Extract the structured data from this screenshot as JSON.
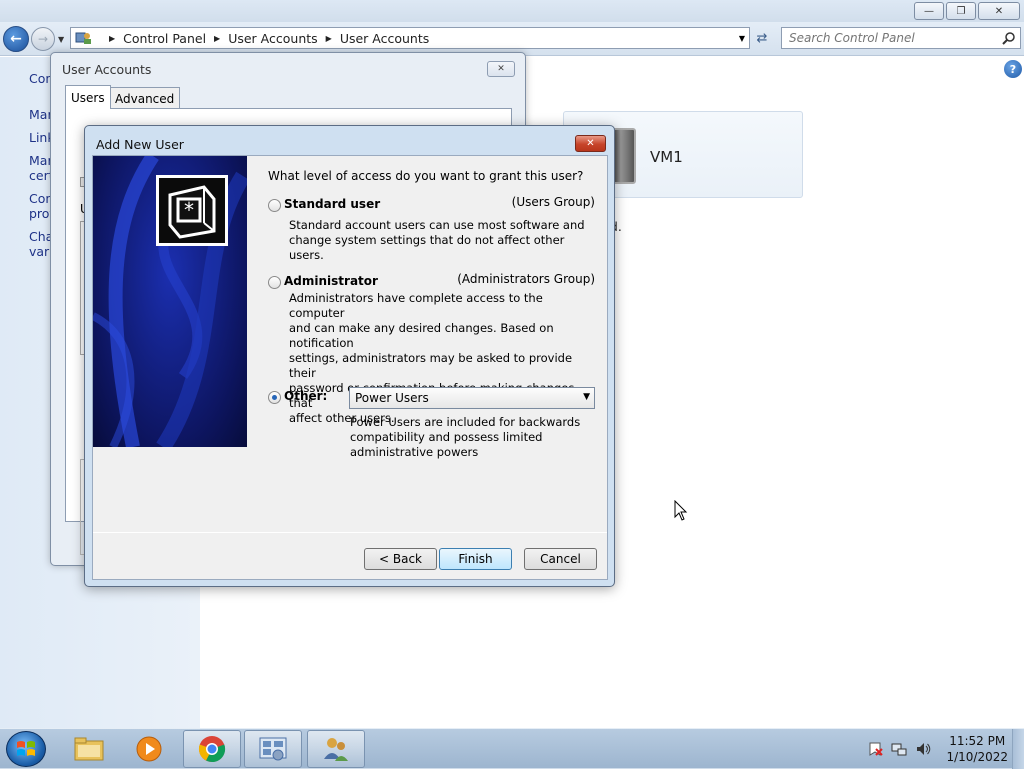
{
  "explorer": {
    "breadcrumbs": [
      "Control Panel",
      "User Accounts",
      "User Accounts"
    ],
    "search_placeholder": "Search Control Panel",
    "left_links": [
      "Con",
      "Mar",
      "Link",
      "Mar",
      "cert",
      "Con",
      "prof",
      "Cha",
      "varia"
    ],
    "user_tile_name": "VM1",
    "bg_fragment": "rd."
  },
  "user_accounts_dialog": {
    "title": "User Accounts",
    "tabs": [
      "Users",
      "Advanced"
    ],
    "fragments": [
      "U"
    ]
  },
  "add_new_user": {
    "title": "Add New User",
    "question": "What level of access do you want to grant this user?",
    "options": [
      {
        "label": "Standard user",
        "group": "(Users Group)",
        "description": [
          "Standard account users can use most software and",
          "change system settings that do not affect other users."
        ],
        "selected": false
      },
      {
        "label": "Administrator",
        "group": "(Administrators Group)",
        "description": [
          "Administrators have complete access to the computer",
          "and can make any desired changes. Based on notification",
          "settings, administrators may be asked to provide their",
          "password or confirmation before making changes that",
          "affect other users."
        ],
        "selected": false
      },
      {
        "label": "Other:",
        "selected": true,
        "select_value": "Power Users",
        "description": [
          "Power Users are included for backwards",
          "compatibility and possess limited",
          "administrative powers"
        ]
      }
    ],
    "buttons": {
      "back": "< Back",
      "finish": "Finish",
      "cancel": "Cancel"
    }
  },
  "taskbar": {
    "time": "11:52 PM",
    "date": "1/10/2022",
    "items": [
      "windows-explorer",
      "media-player",
      "chrome",
      "control-panel",
      "user-accounts"
    ]
  },
  "colors": {
    "accent_blue": "#1e3287",
    "close_red": "#c7442a",
    "banner_blue": "#1b2fb0"
  }
}
